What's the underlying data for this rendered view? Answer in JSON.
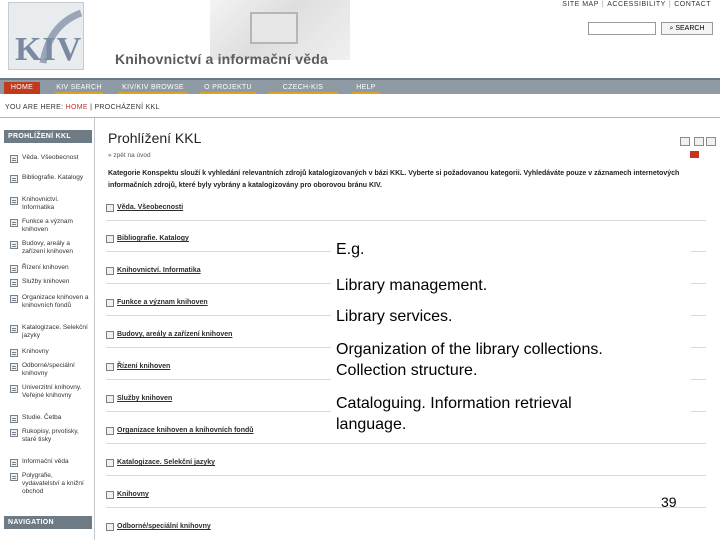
{
  "header": {
    "logo": "KIV",
    "title": "Knihovnictví a informační věda",
    "top_links": [
      "SITE MAP",
      "ACCESSIBILITY",
      "CONTACT"
    ],
    "search_placeholder": "",
    "search_button": "SEARCH"
  },
  "nav": {
    "tabs": [
      {
        "label": "HOME",
        "active": true
      },
      {
        "label": "KIV SEARCH",
        "active": false
      },
      {
        "label": "KIV/KIV BROWSE",
        "active": false
      },
      {
        "label": "O PROJEKTU",
        "active": false
      },
      {
        "label": "CZECH-KIS PORTAL",
        "active": false
      },
      {
        "label": "HELP",
        "active": false
      }
    ]
  },
  "breadcrumb": {
    "prefix": "YOU ARE HERE:",
    "home": "HOME",
    "separator": "|",
    "current": "PROCHÁZENÍ KKL"
  },
  "sidebar": {
    "heading": "PROHLÍŽENÍ KKL",
    "items": [
      "Věda. Všeobecnost",
      "Bibliografie. Katalogy",
      "Knihovnictví. Informatika",
      "Funkce a význam knihoven",
      "Budovy, areály a zařízení knihoven",
      "Řízení knihoven",
      "Služby knihoven",
      "Organizace knihoven a knihovních fondů",
      "Katalogizace. Selekční jazyky",
      "Knihovny",
      "Odborné/speciální knihovny",
      "Univerzitní knihovny. Veřejné knihovny",
      "Studie. Četba",
      "Rukopisy, prvotisky, staré tisky",
      "Informační věda",
      "Polygrafie, vydavatelství a knižní obchod"
    ],
    "nav_heading": "NAVIGATION"
  },
  "main": {
    "title": "Prohlížení KKL",
    "back_link": "« zpět na úvod",
    "intro": "Kategorie Konspektu slouží k vyhledání relevantních zdrojů katalogizovaných v bázi KKL. Vyberte si požadovanou kategorii. Vyhledáváte pouze v záznamech internetových informačních zdrojů, které byly vybrány a katalogizovány pro oborovou bránu KIV.",
    "categories": [
      "Věda. Všeobecnosti",
      "Bibliografie. Katalogy",
      "Knihovnictví. Informatika",
      "Funkce a význam knihoven",
      "Budovy, areály a zařízení knihoven",
      "Řízení knihoven",
      "Služby knihoven",
      "Organizace knihoven a knihovních fondů",
      "Katalogizace. Selekční jazyky",
      "Knihovny",
      "Odborné/speciální knihovny"
    ]
  },
  "overlay": {
    "lines": [
      "E.g.",
      "Library management.",
      "Library services.",
      "Organization of the library collections.",
      "Collection structure.",
      "Cataloguing. Information retrieval",
      "language."
    ],
    "page_number": "39"
  },
  "colors": {
    "nav_bg": "#8e9aa4",
    "nav_active": "#c03a1e",
    "nav_underline": "#d8a428",
    "side_heading_bg": "#6e7b85"
  }
}
